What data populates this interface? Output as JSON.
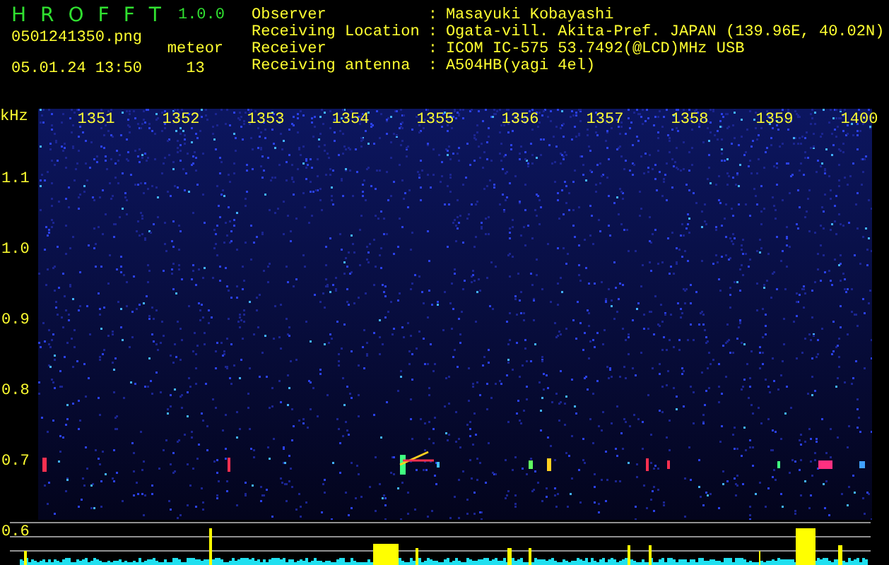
{
  "app": {
    "title_letters": [
      "H",
      "R",
      "O",
      "F",
      "F",
      "T"
    ],
    "version": "1.0.0",
    "filename": "0501241350.png",
    "datetime": "05.01.24 13:50",
    "meteor_label": "meteor",
    "meteor_count": "13"
  },
  "info": [
    {
      "label": "Observer",
      "separator": ":",
      "value": "Masayuki Kobayashi"
    },
    {
      "label": "Receiving Location",
      "separator": ":",
      "value": "Ogata-vill. Akita-Pref. JAPAN (139.96E, 40.02N)"
    },
    {
      "label": "Receiver",
      "separator": ":",
      "value": "ICOM IC-575 53.7492(@LCD)MHz USB"
    },
    {
      "label": "Receiving antenna",
      "separator": ":",
      "value": "A504HB(yagi 4el)"
    }
  ],
  "y_axis": {
    "unit": "kHz",
    "ticks": [
      "1.1",
      "1.0",
      "0.9",
      "0.8",
      "0.7",
      "0.6"
    ]
  },
  "time_labels": [
    "1351",
    "1352",
    "1353",
    "1354",
    "1355",
    "1356",
    "1357",
    "1358",
    "1359",
    "1400"
  ]
}
